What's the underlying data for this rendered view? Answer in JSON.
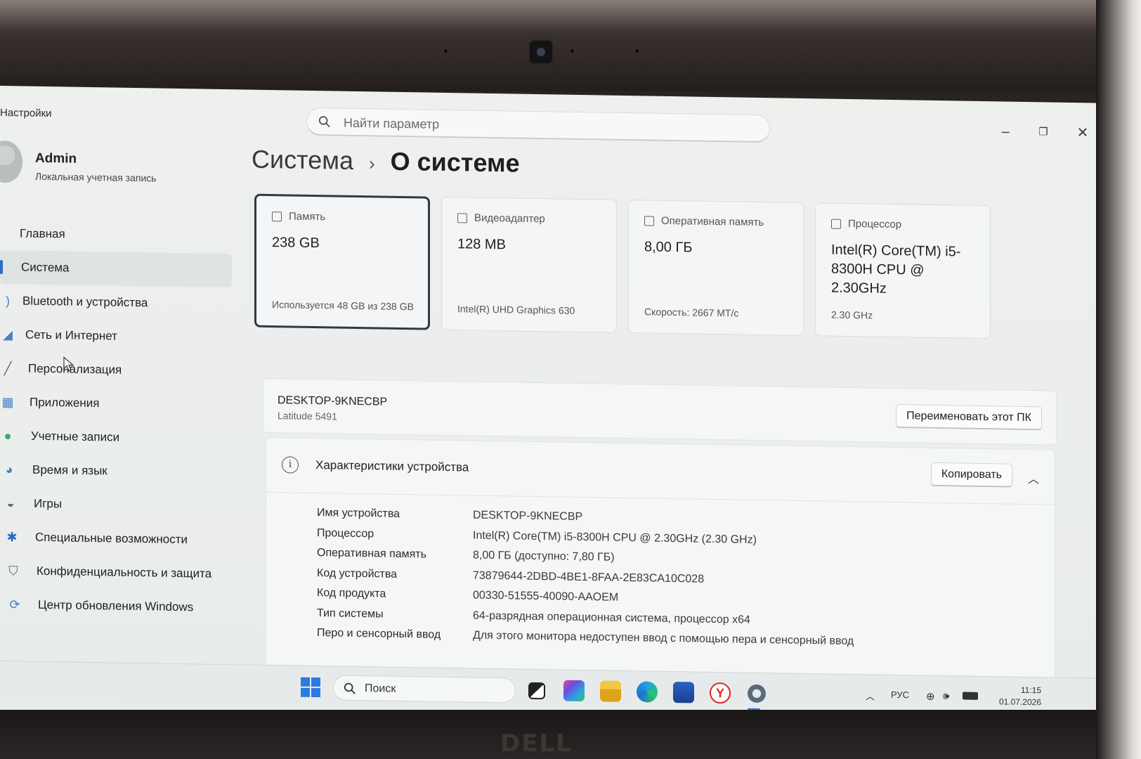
{
  "window": {
    "app_title": "Настройки",
    "search_placeholder": "Найти параметр"
  },
  "profile": {
    "name": "Admin",
    "account_type": "Локальная учетная запись"
  },
  "sidebar": {
    "items": [
      {
        "label": "Главная",
        "icon": "home-icon"
      },
      {
        "label": "Система",
        "icon": "system-icon",
        "active": true
      },
      {
        "label": "Bluetooth и устройства",
        "icon": "bluetooth-icon"
      },
      {
        "label": "Сеть и Интернет",
        "icon": "network-icon"
      },
      {
        "label": "Персонализация",
        "icon": "brush-icon"
      },
      {
        "label": "Приложения",
        "icon": "apps-icon"
      },
      {
        "label": "Учетные записи",
        "icon": "account-icon"
      },
      {
        "label": "Время и язык",
        "icon": "globe-icon"
      },
      {
        "label": "Игры",
        "icon": "gamepad-icon"
      },
      {
        "label": "Специальные возможности",
        "icon": "accessibility-icon"
      },
      {
        "label": "Конфиденциальность и защита",
        "icon": "shield-icon"
      },
      {
        "label": "Центр обновления Windows",
        "icon": "update-icon"
      }
    ]
  },
  "breadcrumb": {
    "parent": "Система",
    "separator": "›",
    "current": "О системе"
  },
  "cards": [
    {
      "heading": "Память",
      "value": "238 GB",
      "sub": "Используется 48 GB из 238 GB",
      "icon": "storage-icon"
    },
    {
      "heading": "Видеоадаптер",
      "value": "128 MB",
      "sub": "Intel(R) UHD Graphics 630",
      "icon": "gpu-icon"
    },
    {
      "heading": "Оперативная память",
      "value": "8,00 ГБ",
      "sub": "Скорость: 2667 MT/c",
      "icon": "ram-icon"
    },
    {
      "heading": "Процессор",
      "value": "Intel(R) Core(TM) i5-8300H CPU @ 2.30GHz",
      "sub": "2.30 GHz",
      "icon": "cpu-icon"
    }
  ],
  "device": {
    "name": "DESKTOP-9KNECBP",
    "model": "Latitude 5491",
    "rename_label": "Переименовать этот ПК"
  },
  "specs": {
    "title": "Характеристики устройства",
    "copy_label": "Копировать",
    "rows": [
      {
        "key": "Имя устройства",
        "value": "DESKTOP-9KNECBP"
      },
      {
        "key": "Процессор",
        "value": "Intel(R) Core(TM) i5-8300H CPU @ 2.30GHz (2.30 GHz)"
      },
      {
        "key": "Оперативная память",
        "value": "8,00 ГБ (доступно: 7,80 ГБ)"
      },
      {
        "key": "Код устройства",
        "value": "73879644-2DBD-4BE1-8FAA-2E83CA10C028"
      },
      {
        "key": "Код продукта",
        "value": "00330-51555-40090-AAOEM"
      },
      {
        "key": "Тип системы",
        "value": "64-разрядная операционная система, процессор x64"
      },
      {
        "key": "Перо и сенсорный ввод",
        "value": "Для этого монитора недоступен ввод с помощью пера и сенсорный ввод"
      }
    ]
  },
  "taskbar": {
    "search_label": "Поиск",
    "language": "РУС",
    "time": "11:15",
    "date": "01.07.2026"
  },
  "bezel": {
    "logo": "DELL"
  },
  "colors": {
    "accent": "#2a7be0",
    "nav_indicator": "#2b6bc4",
    "window_bg": "#eef0ee"
  }
}
